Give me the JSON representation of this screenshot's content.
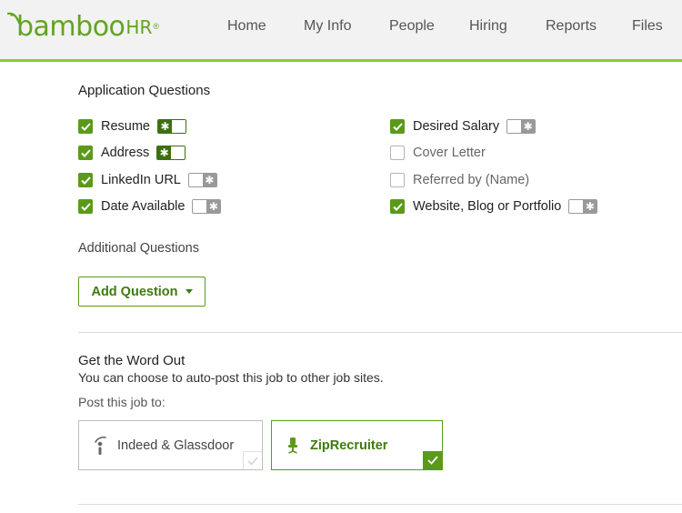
{
  "brand": {
    "logo_main": "bamboo",
    "logo_suffix": "HR",
    "logo_mark": "®",
    "color": "#62a420"
  },
  "nav": {
    "items": [
      {
        "label": "Home"
      },
      {
        "label": "My Info"
      },
      {
        "label": "People"
      },
      {
        "label": "Hiring"
      },
      {
        "label": "Reports"
      },
      {
        "label": "Files"
      }
    ]
  },
  "application_questions": {
    "title": "Application Questions",
    "left": [
      {
        "label": "Resume",
        "checked": true,
        "required": true
      },
      {
        "label": "Address",
        "checked": true,
        "required": true
      },
      {
        "label": "LinkedIn URL",
        "checked": true,
        "required": false
      },
      {
        "label": "Date Available",
        "checked": true,
        "required": false
      }
    ],
    "right": [
      {
        "label": "Desired Salary",
        "checked": true,
        "required": false
      },
      {
        "label": "Cover Letter",
        "checked": false
      },
      {
        "label": "Referred by (Name)",
        "checked": false
      },
      {
        "label": "Website, Blog or Portfolio",
        "checked": true,
        "required": false
      }
    ],
    "toggle_symbol": "✱"
  },
  "additional_questions": {
    "title": "Additional Questions",
    "add_button_label": "Add Question"
  },
  "word_out": {
    "title": "Get the Word Out",
    "description": "You can choose to auto-post this job to other job sites.",
    "post_label": "Post this job to:",
    "sites": [
      {
        "label": "Indeed & Glassdoor",
        "selected": false
      },
      {
        "label": "ZipRecruiter",
        "selected": true
      }
    ]
  },
  "colors": {
    "accent": "#5a9a1a",
    "accent_dark": "#3e6f0f",
    "header_bg": "#f2f2f2",
    "header_border": "#8cc63f"
  }
}
